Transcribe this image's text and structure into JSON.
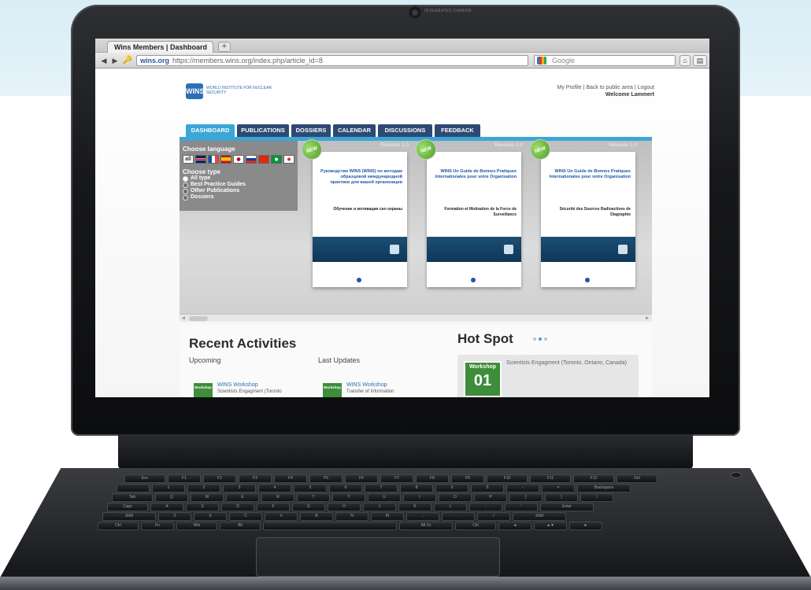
{
  "camera_label": "INTEGRATED CAMERA",
  "browser": {
    "tab_title": "Wins Members | Dashboard",
    "new_tab": "+",
    "url_domain": "wins.org",
    "url": "https://members.wins.org/index.php/article_id=8",
    "search_placeholder": "Google"
  },
  "site": {
    "logo_mark": "WINS",
    "logo_text": "WORLD INSTITUTE FOR NUCLEAR SECURITY",
    "top_links": "My Profile | Back to public area | Logout",
    "welcome": "Welcome Lammert",
    "nav_tabs": [
      "DASHBOARD",
      "PUBLICATIONS",
      "DOSSIERS",
      "CALENDAR",
      "DISCUSSIONS",
      "FEEDBACK"
    ],
    "active_tab": "DASHBOARD"
  },
  "filter": {
    "language_title": "Choose language",
    "all_label": "all",
    "flags": [
      "#c8102e",
      "#ffffff",
      "#0055a4",
      "#ffffff",
      "#c8102e",
      "#fcd116",
      "#0039a6",
      "#de2910",
      "#009639",
      "#ffffff"
    ],
    "type_title": "Choose type",
    "types": [
      "All type",
      "Best Practice Guides",
      "Other Publications",
      "Dossiers"
    ],
    "selected_type": "All type"
  },
  "books": [
    {
      "revision": "Revision 1.0",
      "badge": "NEW",
      "title": "Руководство WINS (WINS) по методам образцовой международной практики для вашей организации",
      "subtitle": "Обучение и мотивация сил охраны"
    },
    {
      "revision": "Revision 1.0",
      "badge": "NEW",
      "title": "WINS Un Guide de Bonnes Pratiques Internationales pour votre Organisation",
      "subtitle": "Formation et Motivation de la Force de Surveillance"
    },
    {
      "revision": "Revision 1.0",
      "badge": "NEW",
      "title": "WINS Un Guide de Bonnes Pratiques Internationales pour votre Organisation",
      "subtitle": "Sécurité des Sources Radioactives de Diagraphie"
    }
  ],
  "recent": {
    "title": "Recent Activities",
    "upcoming_label": "Upcoming",
    "last_updates_label": "Last Updates",
    "upcoming_item": {
      "badge": "Workshop",
      "title": "WINS Workshop",
      "subtitle": "Scientists Engagment (Toronto"
    },
    "last_item": {
      "badge": "Workshop",
      "title": "WINS Workshop",
      "subtitle": "Transfer of Information"
    }
  },
  "hotspot": {
    "title": "Hot Spot",
    "badge_label": "Workshop",
    "badge_number": "01",
    "text": "Scientists Engagment (Toronto, Ontario, Canada)"
  },
  "keyboard_rows": [
    [
      "Esc",
      "F1",
      "F2",
      "F3",
      "F4",
      "F5",
      "F6",
      "F7",
      "F8",
      "F9",
      "F10",
      "F11",
      "F12",
      "Del"
    ],
    [
      "`",
      "1",
      "2",
      "3",
      "4",
      "5",
      "6",
      "7",
      "8",
      "9",
      "0",
      "-",
      "=",
      "Backspace"
    ],
    [
      "Tab",
      "Q",
      "W",
      "E",
      "R",
      "T",
      "Y",
      "U",
      "I",
      "O",
      "P",
      "[",
      "]",
      "\\"
    ],
    [
      "Caps",
      "A",
      "S",
      "D",
      "F",
      "G",
      "H",
      "J",
      "K",
      "L",
      ";",
      "'",
      "Enter"
    ],
    [
      "Shift",
      "Z",
      "X",
      "C",
      "V",
      "B",
      "N",
      "M",
      ",",
      ".",
      "/",
      "Shift"
    ],
    [
      "Ctrl",
      "Fn",
      "Win",
      "Alt",
      "",
      "Alt Gr",
      "Ctrl",
      "◄",
      "▲▼",
      "►"
    ]
  ],
  "colors": {
    "accent": "#3ca6d6",
    "nav": "#2c4a73",
    "workshop": "#3d8d3a"
  }
}
